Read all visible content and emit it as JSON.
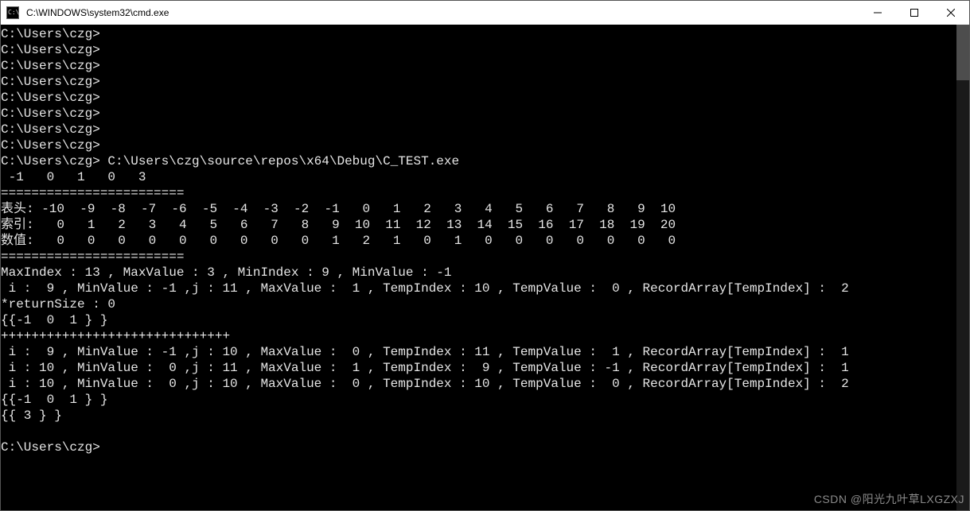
{
  "window": {
    "title": "C:\\WINDOWS\\system32\\cmd.exe",
    "app_icon_text": "C:\\"
  },
  "terminal": {
    "prompt": "C:\\Users\\czg>",
    "command": "C:\\Users\\czg\\source\\repos\\x64\\Debug\\C_TEST.exe",
    "blank_prompt_count_top": 8,
    "input_line": " -1   0   1   0   3",
    "sep_eq": "========================",
    "header_label": "表头:",
    "header_values": "-10  -9  -8  -7  -6  -5  -4  -3  -2  -1   0   1   2   3   4   5   6   7   8   9  10",
    "index_label": "索引:",
    "index_values": "  0   1   2   3   4   5   6   7   8   9  10  11  12  13  14  15  16  17  18  19  20",
    "value_label": "数值:",
    "value_values": "  0   0   0   0   0   0   0   0   0   1   2   1   0   1   0   0   0   0   0   0   0",
    "maxmin_line": "MaxIndex : 13 , MaxValue : 3 , MinIndex : 9 , MinValue : -1",
    "detail_line_1": " i :  9 , MinValue : -1 ,j : 11 , MaxValue :  1 , TempIndex : 10 , TempValue :  0 , RecordArray[TempIndex] :  2",
    "return_line": "*returnSize : 0",
    "set_line_1": "{{-1  0  1 } }",
    "plus_line": "++++++++++++++++++++++++++++++",
    "detail_line_2": " i :  9 , MinValue : -1 ,j : 10 , MaxValue :  0 , TempIndex : 11 , TempValue :  1 , RecordArray[TempIndex] :  1",
    "detail_line_3": " i : 10 , MinValue :  0 ,j : 11 , MaxValue :  1 , TempIndex :  9 , TempValue : -1 , RecordArray[TempIndex] :  1",
    "detail_line_4": " i : 10 , MinValue :  0 ,j : 10 , MaxValue :  0 , TempIndex : 10 , TempValue :  0 , RecordArray[TempIndex] :  2",
    "set_line_2": "{{ 3 } }"
  },
  "watermark": "CSDN @阳光九叶草LXGZXJ",
  "chart_data": {
    "type": "table",
    "title": "Counting array dump",
    "columns_header": [
      -10,
      -9,
      -8,
      -7,
      -6,
      -5,
      -4,
      -3,
      -2,
      -1,
      0,
      1,
      2,
      3,
      4,
      5,
      6,
      7,
      8,
      9,
      10
    ],
    "columns_index": [
      0,
      1,
      2,
      3,
      4,
      5,
      6,
      7,
      8,
      9,
      10,
      11,
      12,
      13,
      14,
      15,
      16,
      17,
      18,
      19,
      20
    ],
    "columns_value": [
      0,
      0,
      0,
      0,
      0,
      0,
      0,
      0,
      0,
      1,
      2,
      1,
      0,
      1,
      0,
      0,
      0,
      0,
      0,
      0,
      0
    ],
    "input_array": [
      -1,
      0,
      1,
      0,
      3
    ],
    "MaxIndex": 13,
    "MaxValue": 3,
    "MinIndex": 9,
    "MinValue": -1,
    "iterations": [
      {
        "i": 9,
        "MinValue": -1,
        "j": 11,
        "MaxValue": 1,
        "TempIndex": 10,
        "TempValue": 0,
        "RecordArray_TempIndex": 2
      },
      {
        "i": 9,
        "MinValue": -1,
        "j": 10,
        "MaxValue": 0,
        "TempIndex": 11,
        "TempValue": 1,
        "RecordArray_TempIndex": 1
      },
      {
        "i": 10,
        "MinValue": 0,
        "j": 11,
        "MaxValue": 1,
        "TempIndex": 9,
        "TempValue": -1,
        "RecordArray_TempIndex": 1
      },
      {
        "i": 10,
        "MinValue": 0,
        "j": 10,
        "MaxValue": 0,
        "TempIndex": 10,
        "TempValue": 0,
        "RecordArray_TempIndex": 2
      }
    ],
    "returnSize": 0,
    "result_sets": [
      [
        -1,
        0,
        1
      ],
      [
        3
      ]
    ]
  }
}
